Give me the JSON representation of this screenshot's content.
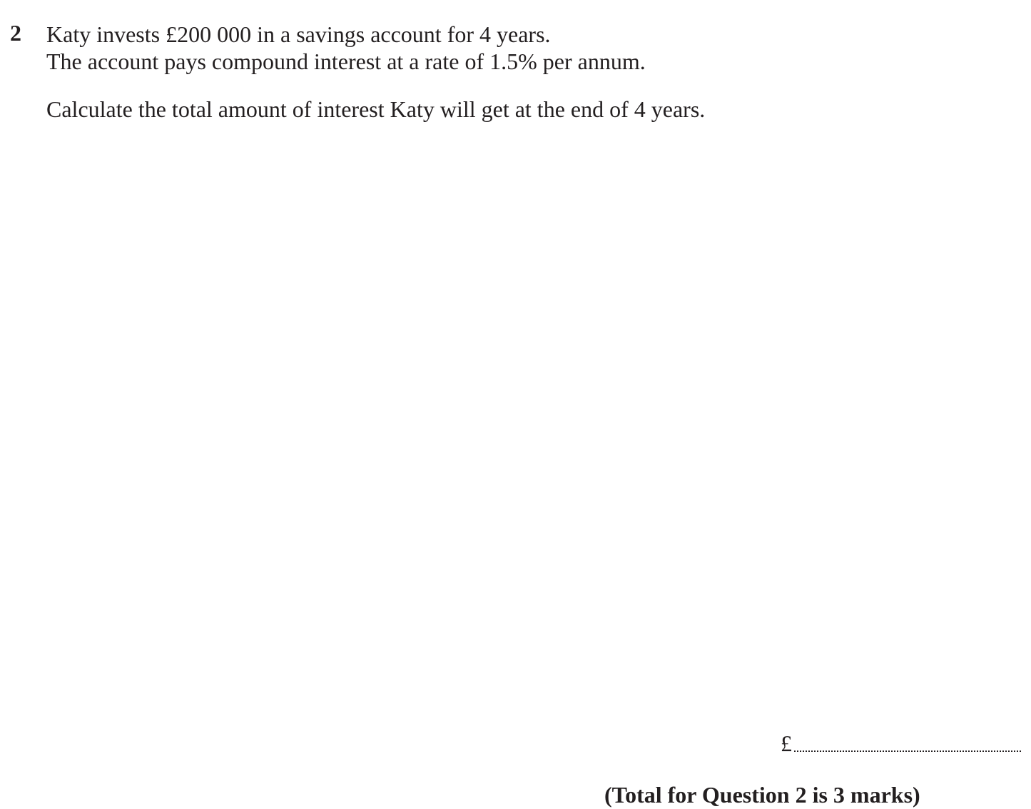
{
  "question": {
    "number": "2",
    "line1": "Katy invests £200 000 in a savings account for 4 years.",
    "line2": "The account pays compound interest at a rate of 1.5% per annum.",
    "instruction": "Calculate the total amount of interest Katy will get at the end of 4 years."
  },
  "answer": {
    "currency": "£",
    "value": ""
  },
  "footer": {
    "total": "(Total for Question 2 is 3 marks)"
  }
}
